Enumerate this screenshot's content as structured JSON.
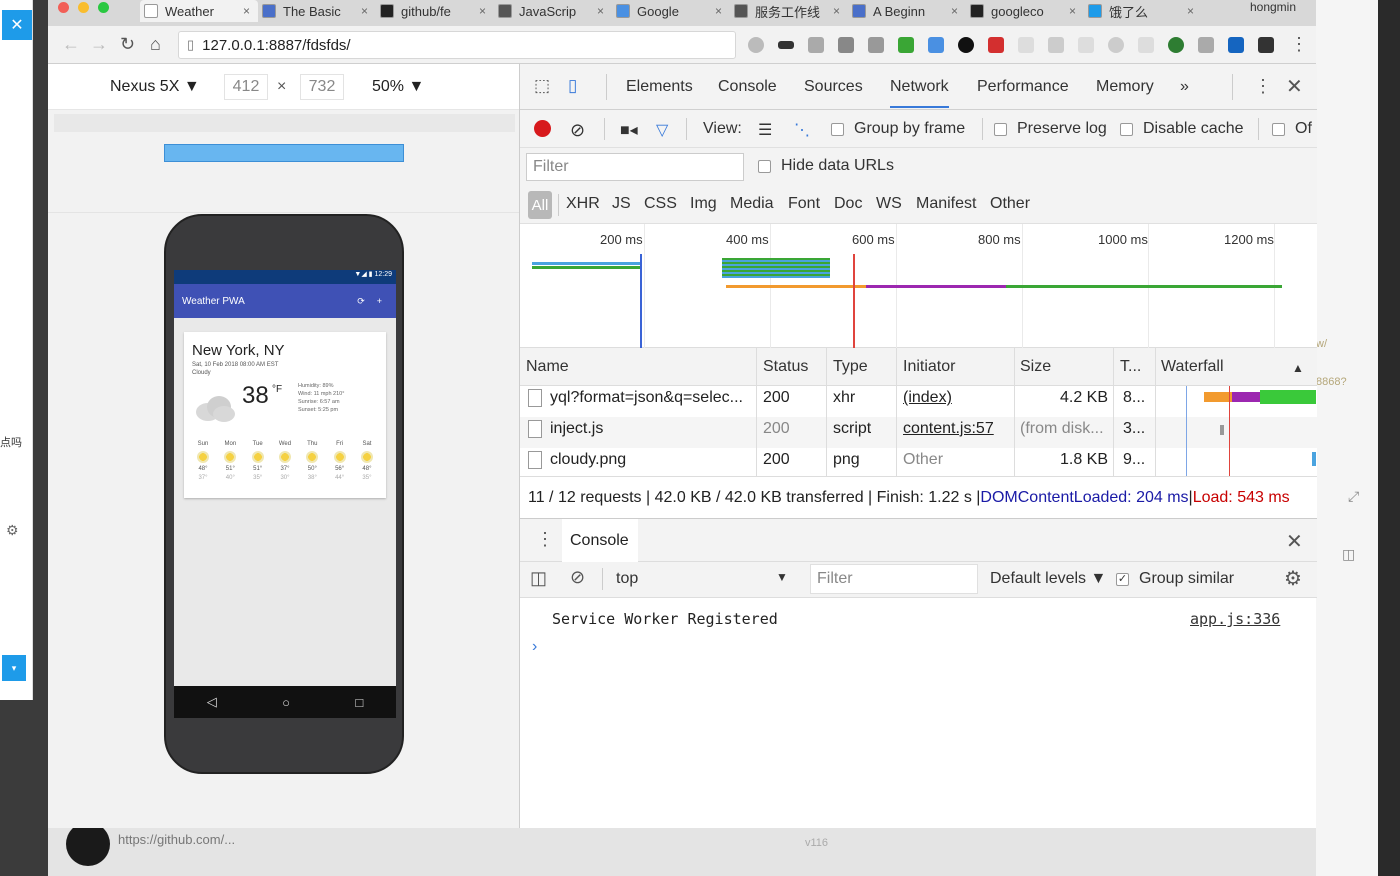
{
  "browser": {
    "tabs": [
      {
        "title": "Weather",
        "icon_color": "#ffffff"
      },
      {
        "title": "The Basic",
        "icon_color": "#4a6fc9"
      },
      {
        "title": "github/fe",
        "icon_color": "#222222"
      },
      {
        "title": "JavaScrip",
        "icon_color": "#555555"
      },
      {
        "title": "Google",
        "icon_color": "#4a90e2"
      },
      {
        "title": "服务工作线",
        "icon_color": "#555555"
      },
      {
        "title": "A Beginn",
        "icon_color": "#4a6fc9"
      },
      {
        "title": "googleco",
        "icon_color": "#222222"
      },
      {
        "title": "饿了么",
        "icon_color": "#1e9be9"
      }
    ],
    "user": "hongmin",
    "url": "127.0.0.1:8887/fdsfds/"
  },
  "device_toolbar": {
    "device": "Nexus 5X ▼",
    "width": "412",
    "x": "×",
    "height": "732",
    "zoom": "50% ▼"
  },
  "app": {
    "title": "Weather PWA",
    "status": "▼◢ ▮ 12:29",
    "city": "New York, NY",
    "date": "Sat, 10 Feb 2018 08:00 AM EST",
    "description": "Cloudy",
    "temperature": "38",
    "unit": "°F",
    "details": [
      "Humidity: 89%",
      "Wind: 11 mph 210°",
      "Sunrise: 6:57 am",
      "Sunset: 5:25 pm"
    ],
    "forecast": [
      {
        "day": "Sun",
        "high": "48°",
        "low": "37°"
      },
      {
        "day": "Mon",
        "high": "51°",
        "low": "40°"
      },
      {
        "day": "Tue",
        "high": "51°",
        "low": "35°"
      },
      {
        "day": "Wed",
        "high": "37°",
        "low": "30°"
      },
      {
        "day": "Thu",
        "high": "50°",
        "low": "38°"
      },
      {
        "day": "Fri",
        "high": "56°",
        "low": "44°"
      },
      {
        "day": "Sat",
        "high": "48°",
        "low": "35°"
      }
    ]
  },
  "devtools": {
    "tabs": [
      "Elements",
      "Console",
      "Sources",
      "Network",
      "Performance",
      "Memory",
      "»"
    ],
    "active_tab": "Network",
    "network_toolbar": {
      "view_label": "View:",
      "group_by_frame": "Group by frame",
      "preserve_log": "Preserve log",
      "disable_cache": "Disable cache",
      "offline": "Of"
    },
    "filter_placeholder": "Filter",
    "hide_data_urls": "Hide data URLs",
    "types": [
      "All",
      "XHR",
      "JS",
      "CSS",
      "Img",
      "Media",
      "Font",
      "Doc",
      "WS",
      "Manifest",
      "Other"
    ],
    "ticks": [
      "200 ms",
      "400 ms",
      "600 ms",
      "800 ms",
      "1000 ms",
      "1200 ms"
    ],
    "columns": [
      "Name",
      "Status",
      "Type",
      "Initiator",
      "Size",
      "T...",
      "Waterfall"
    ],
    "rows": [
      {
        "name": "yql?format=json&q=selec...",
        "status": "200",
        "type": "xhr",
        "initiator": "(index)",
        "size": "4.2 KB",
        "time": "8..."
      },
      {
        "name": "inject.js",
        "status": "200",
        "type": "script",
        "initiator": "content.js:57",
        "size": "(from disk...",
        "time": "3..."
      },
      {
        "name": "cloudy.png",
        "status": "200",
        "type": "png",
        "initiator": "Other",
        "size": "1.8 KB",
        "time": "9..."
      }
    ],
    "summary": {
      "main": "11 / 12 requests | 42.0 KB / 42.0 KB transferred | Finish: 1.22 s | ",
      "dcl": "DOMContentLoaded: 204 ms",
      "sep": " | ",
      "load": "Load: 543 ms"
    },
    "drawer_tab": "Console",
    "console": {
      "context": "top",
      "filter_placeholder": "Filter",
      "levels": "Default levels ▼",
      "group_similar": "Group similar",
      "message": "Service Worker Registered",
      "source": "app.js:336",
      "prompt": "›"
    }
  },
  "page_bottom": {
    "link": "https://github.com/...",
    "footer": "v116"
  },
  "left_panel": {
    "label": "点吗"
  }
}
